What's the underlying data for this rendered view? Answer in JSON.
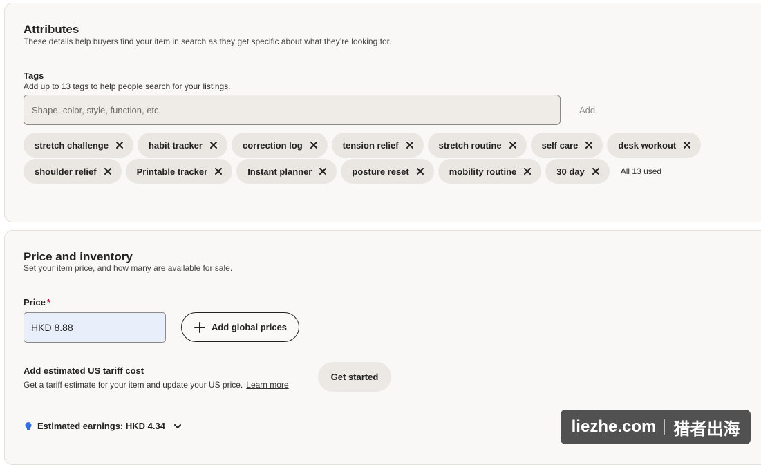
{
  "attributes": {
    "title": "Attributes",
    "subtitle": "These details help buyers find your item in search as they get specific about what they’re looking for.",
    "tags": {
      "label": "Tags",
      "help": "Add up to 13 tags to help people search for your listings.",
      "input_placeholder": "Shape, color, style, function, etc.",
      "input_value": "",
      "add_label": "Add",
      "row1": [
        "stretch challenge",
        "habit tracker",
        "correction log",
        "tension relief",
        "stretch routine",
        "self care",
        "desk workout"
      ],
      "row2": [
        "shoulder relief",
        "Printable tracker",
        "Instant planner",
        "posture reset",
        "mobility routine",
        "30 day"
      ],
      "used_text": "All 13 used"
    }
  },
  "price_inventory": {
    "title": "Price and inventory",
    "subtitle": "Set your item price, and how many are available for sale.",
    "price_label": "Price",
    "required_mark": "*",
    "price_value": "HKD 8.88",
    "global_prices_label": "Add global prices",
    "tariff": {
      "title": "Add estimated US tariff cost",
      "description": "Get a tariff estimate for your item and update your US price.",
      "learn_more": "Learn more",
      "button": "Get started"
    },
    "earnings_label": "Estimated earnings: HKD 4.34"
  },
  "watermark": {
    "left": "liezhe.com",
    "right": "猎者出海"
  },
  "colors": {
    "card_bg": "#f9f8f6",
    "chip_bg": "#eae6e1",
    "price_input_bg": "#e8effa",
    "required": "#b3134a",
    "bulb": "#2f6fdc"
  }
}
